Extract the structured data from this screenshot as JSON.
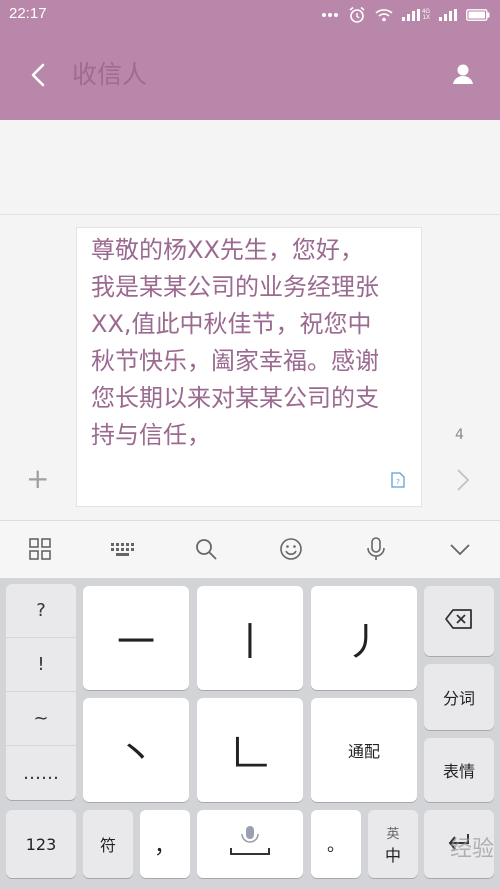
{
  "status_bar": {
    "time": "22:17",
    "network_label": "4G",
    "signal_label": "1X"
  },
  "header": {
    "recipient_placeholder": "收信人"
  },
  "compose": {
    "message": "尊敬的杨XX先生，您好，我是某某公司的业务经理张XX,值此中秋佳节，祝您中秋节快乐，阖家幸福。感谢您长期以来对某某公司的支持与信任，",
    "char_count": "4",
    "add_symbol": "+"
  },
  "keyboard": {
    "symbols": [
      "?",
      "!",
      "~",
      "……"
    ],
    "stroke_keys": [
      "一",
      "丨",
      "丿",
      "丶",
      "𠃊"
    ],
    "match_label": "通配",
    "segment_label": "分词",
    "emoji_label": "表情",
    "numbers_label": "123",
    "symbols_label": "符",
    "comma_label": "，",
    "period_label": "。",
    "lang_label": "英",
    "lang_sub": "中"
  },
  "watermark": "经验"
}
